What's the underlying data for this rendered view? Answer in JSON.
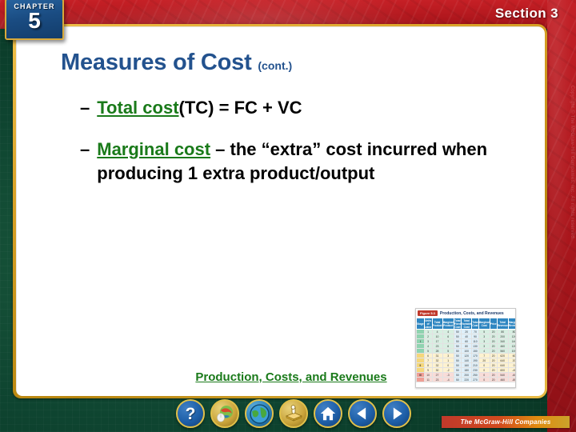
{
  "header": {
    "chapter_label": "CHAPTER",
    "chapter_number": "5",
    "section_label": "Section 3"
  },
  "slide": {
    "title_main": "Measures of Cost",
    "title_suffix": "(cont.)",
    "title_color": "#23528e",
    "keyword_color": "#1a7a1a",
    "bullets": [
      {
        "marker": "–",
        "keyword": "Total cost",
        "rest": "(TC) = FC + VC"
      },
      {
        "marker": "–",
        "keyword": "Marginal cost",
        "rest": " – the “extra” cost incurred when producing 1 extra product/output"
      }
    ]
  },
  "figure": {
    "tag": "Figure 5.3",
    "heading": "Production, Costs, and Revenues",
    "caption": "Production, Costs, and Revenues",
    "columns": [
      "Stage",
      "Units of Labor",
      "Total Product",
      "Marginal Product",
      "Total Fixed Cost",
      "Total Variable Cost",
      "Total Cost",
      "Marginal Cost",
      "Price",
      "Total Revenue",
      "Marginal Revenue",
      "Profit"
    ],
    "rows": [
      {
        "group": "a",
        "stage": "",
        "cells": [
          "1",
          "4",
          "4",
          "50",
          "20",
          "70",
          "5",
          "20",
          "80",
          "80",
          "30"
        ]
      },
      {
        "group": "a",
        "stage": "",
        "cells": [
          "2",
          "10",
          "6",
          "50",
          "40",
          "90",
          "3",
          "20",
          "200",
          "120",
          "110"
        ]
      },
      {
        "group": "a",
        "stage": "I",
        "cells": [
          "3",
          "17",
          "7",
          "50",
          "60",
          "110",
          "3",
          "20",
          "340",
          "140",
          "230"
        ]
      },
      {
        "group": "a",
        "stage": "",
        "cells": [
          "4",
          "23",
          "6",
          "50",
          "80",
          "130",
          "3",
          "20",
          "460",
          "120",
          "330"
        ]
      },
      {
        "group": "a",
        "stage": "",
        "cells": [
          "5",
          "28",
          "5",
          "50",
          "100",
          "150",
          "4",
          "20",
          "560",
          "100",
          "410"
        ]
      },
      {
        "group": "b",
        "stage": "",
        "cells": [
          "6",
          "31",
          "3",
          "50",
          "120",
          "170",
          "7",
          "20",
          "620",
          "60",
          "450"
        ]
      },
      {
        "group": "b",
        "stage": "",
        "cells": [
          "7",
          "32",
          "1",
          "50",
          "140",
          "190",
          "20",
          "20",
          "640",
          "20",
          "450"
        ]
      },
      {
        "group": "b",
        "stage": "II",
        "cells": [
          "8",
          "32",
          "0",
          "50",
          "160",
          "210",
          "0",
          "20",
          "640",
          "0",
          "430"
        ]
      },
      {
        "group": "b",
        "stage": "",
        "cells": [
          "9",
          "30",
          "-2",
          "50",
          "180",
          "230",
          "0",
          "20",
          "600",
          "-40",
          "370"
        ]
      },
      {
        "group": "c",
        "stage": "III",
        "cells": [
          "10",
          "27",
          "-3",
          "50",
          "200",
          "250",
          "0",
          "20",
          "540",
          "-60",
          "290"
        ]
      },
      {
        "group": "c",
        "stage": "",
        "cells": [
          "11",
          "23",
          "-4",
          "50",
          "220",
          "270",
          "0",
          "20",
          "460",
          "-80",
          "190"
        ]
      }
    ]
  },
  "navigation": {
    "buttons": [
      {
        "name": "help-button",
        "icon": "question-mark-icon",
        "glyph": "?"
      },
      {
        "name": "resources-button",
        "icon": "mouse-globe-icon",
        "glyph": ""
      },
      {
        "name": "web-button",
        "icon": "globe-icon",
        "glyph": ""
      },
      {
        "name": "activity-button",
        "icon": "hand-book-icon",
        "glyph": ""
      },
      {
        "name": "home-button",
        "icon": "home-icon",
        "glyph": ""
      },
      {
        "name": "previous-button",
        "icon": "left-triangle-icon",
        "glyph": "◀"
      },
      {
        "name": "next-button",
        "icon": "right-triangle-icon",
        "glyph": "▶"
      }
    ]
  },
  "footer": {
    "publisher_logo_text": "The McGraw-Hill Companies",
    "vertical_copyright": "Copyright © The McGraw-Hill Companies, Inc. All rights reserved."
  }
}
